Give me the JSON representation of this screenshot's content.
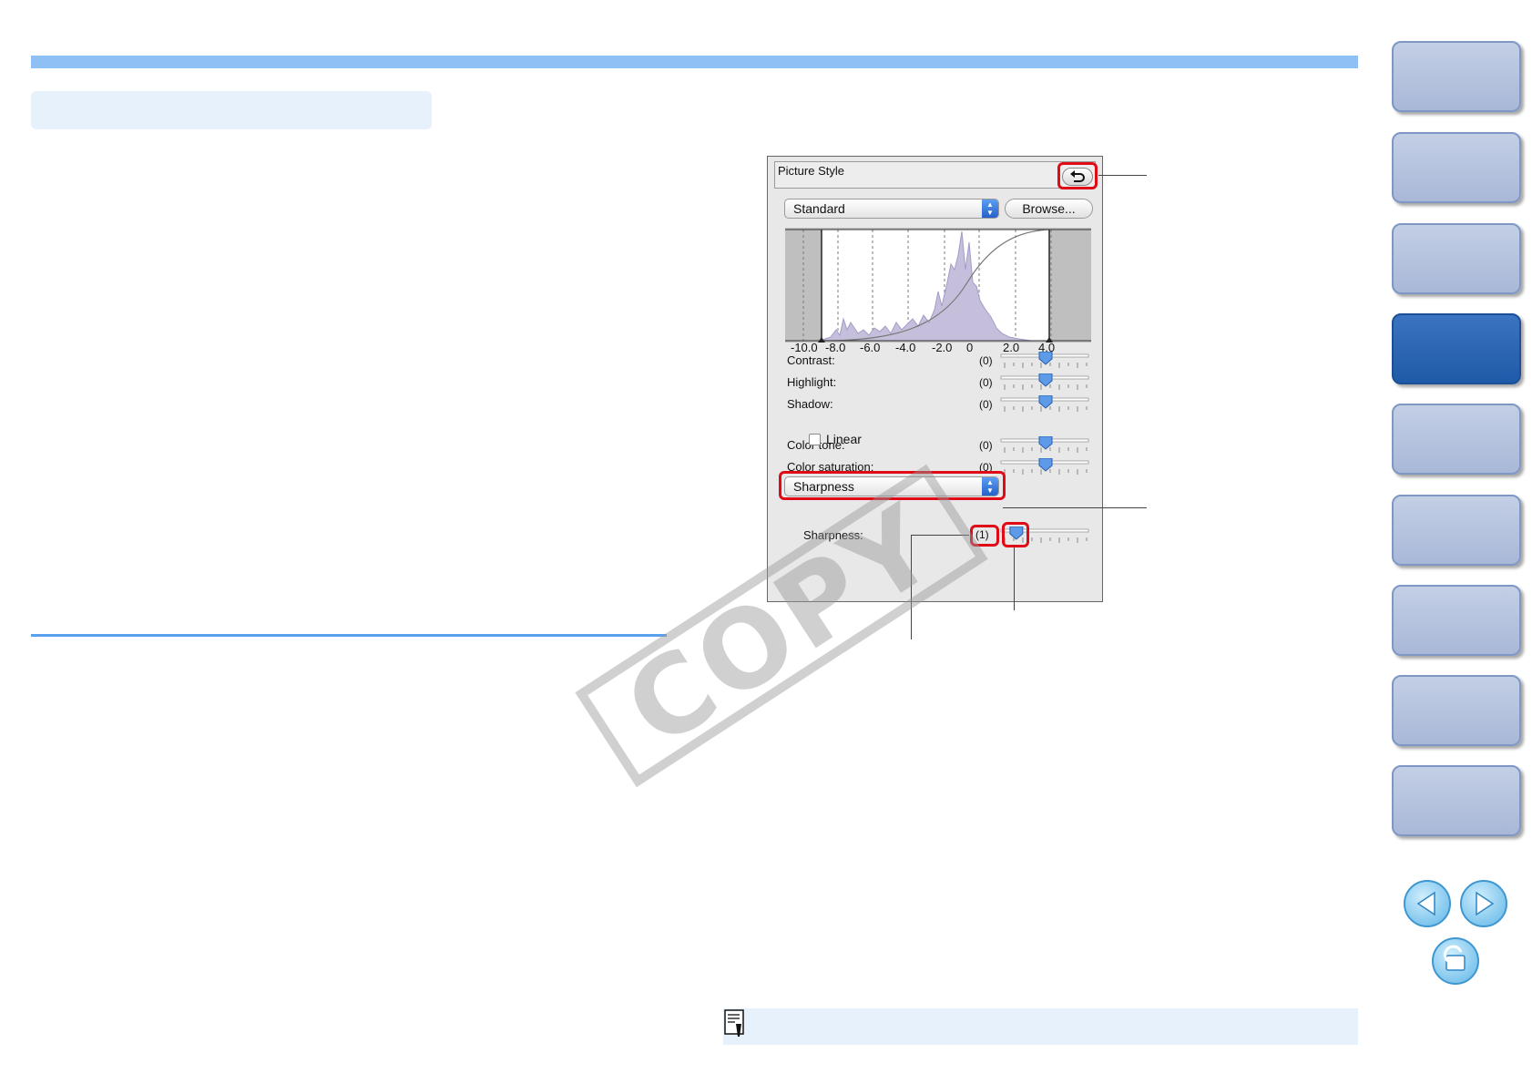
{
  "dialog": {
    "title": "Picture Style",
    "style_select": "Standard",
    "browse_label": "Browse...",
    "axis_ticks": [
      "-10.0",
      "-8.0",
      "-6.0",
      "-4.0",
      "-2.0",
      "0",
      "2.0",
      "4.0"
    ],
    "sliders": [
      {
        "label": "Contrast:",
        "value": "(0)",
        "level": 0
      },
      {
        "label": "Highlight:",
        "value": "(0)",
        "level": 0
      },
      {
        "label": "Shadow:",
        "value": "(0)",
        "level": 0
      },
      {
        "label": "Color tone:",
        "value": "(0)",
        "level": 0
      },
      {
        "label": "Color saturation:",
        "value": "(0)",
        "level": 0
      }
    ],
    "linear_label": "Linear",
    "linear_checked": false,
    "sharpness_select": "Sharpness",
    "sharpness_label": "Sharpness:",
    "sharpness_value": "(1)",
    "sharpness_level": 1
  },
  "watermark": "COPY",
  "colors": {
    "highlight": "#e10a17",
    "tab": "#b3c1de",
    "tab_active": "#2b66b5",
    "accent": "#8ec0f5"
  },
  "side_tabs_active_index": 3
}
